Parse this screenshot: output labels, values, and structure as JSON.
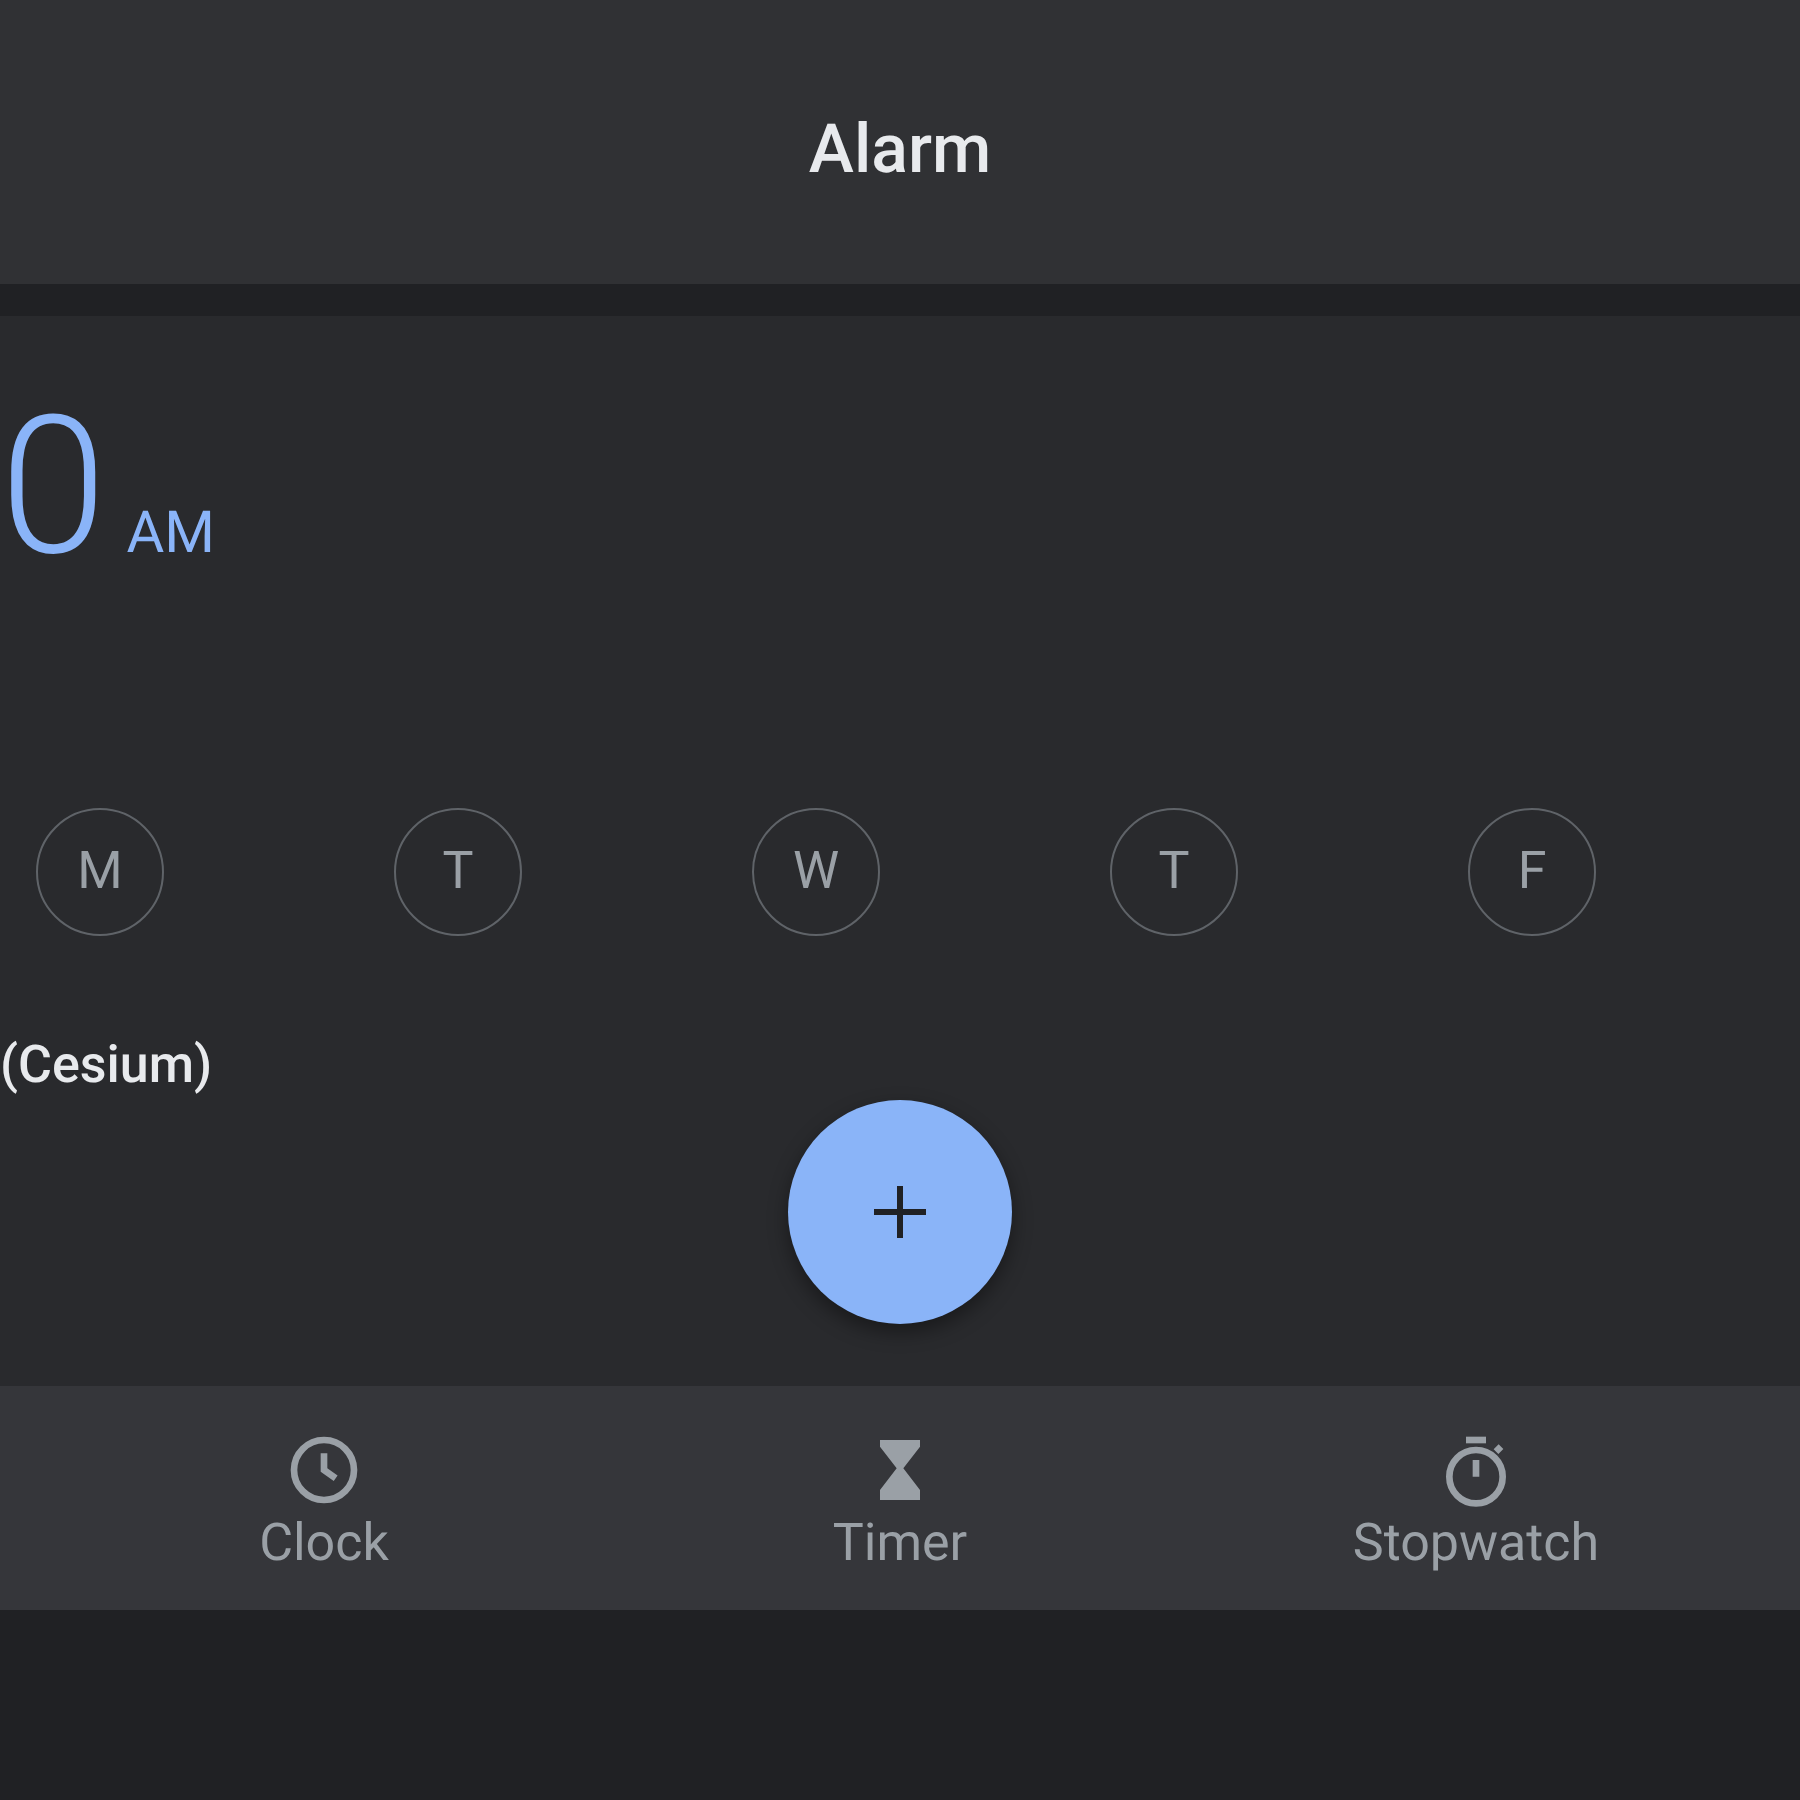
{
  "app_bar": {
    "title": "Alarm"
  },
  "alarm": {
    "time": "0",
    "period": "AM",
    "days": [
      {
        "label": "M",
        "selected": false
      },
      {
        "label": "T",
        "selected": false
      },
      {
        "label": "W",
        "selected": false
      },
      {
        "label": "T",
        "selected": false
      },
      {
        "label": "F",
        "selected": false
      }
    ],
    "sound": "(Cesium)"
  },
  "nav": [
    {
      "label": "Clock",
      "kind": "clock",
      "selected": false
    },
    {
      "label": "Timer",
      "kind": "timer",
      "selected": false
    },
    {
      "label": "Stopwatch",
      "kind": "stopwatch",
      "selected": false
    }
  ]
}
